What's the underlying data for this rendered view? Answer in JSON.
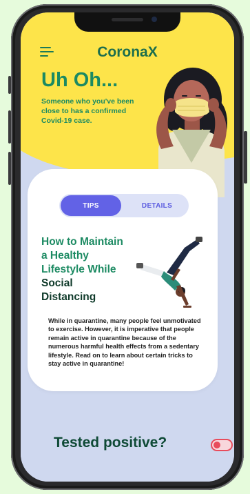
{
  "app": {
    "title": "CoronaX"
  },
  "alert": {
    "headline": "Uh Oh...",
    "message": "Someone who you've been close to has a confirmed Covid-19 case."
  },
  "tabs": [
    {
      "label": "TIPS",
      "active": true
    },
    {
      "label": "DETAILS",
      "active": false
    }
  ],
  "article": {
    "title_green": [
      "How to Maintain",
      "a Healthy",
      "Lifestyle While"
    ],
    "title_dark": [
      "Social",
      "Distancing"
    ],
    "body": "While in quarantine, many people feel unmotivated to exercise. However, it is imperative that people remain active in quarantine because of the numerous harmful health effects from a sedentary lifestyle. Read on to learn about certain tricks to stay active in quarantine!"
  },
  "footer": {
    "question": "Tested positive?",
    "toggle_on": false
  },
  "colors": {
    "yellow": "#fde44a",
    "green": "#1c8a62",
    "dark_green": "#0f4a36",
    "purple": "#6262e6",
    "lavender": "#cfd8ef",
    "red": "#e84c5c"
  }
}
